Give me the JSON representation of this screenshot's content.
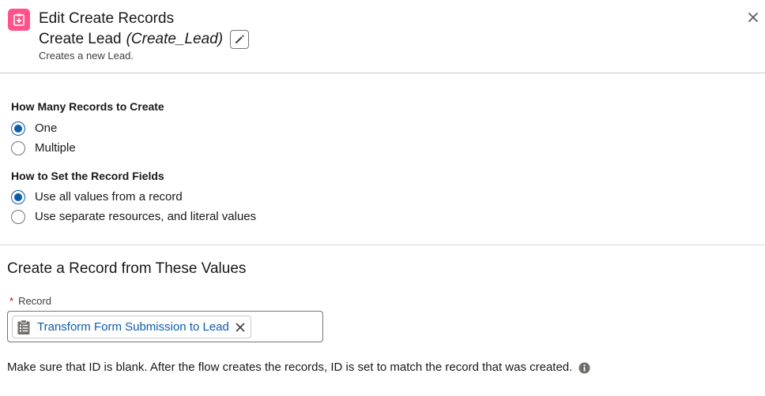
{
  "header": {
    "supertitle": "Edit Create Records",
    "title": "Create Lead",
    "api_name": "(Create_Lead)",
    "description": "Creates a new Lead.",
    "icon": "create-records-icon",
    "icon_color": "#ff538a"
  },
  "how_many": {
    "label": "How Many Records to Create",
    "options": [
      {
        "label": "One",
        "checked": true
      },
      {
        "label": "Multiple",
        "checked": false
      }
    ]
  },
  "how_to_set": {
    "label": "How to Set the Record Fields",
    "options": [
      {
        "label": "Use all values from a record",
        "checked": true
      },
      {
        "label": "Use separate resources, and literal values",
        "checked": false
      }
    ]
  },
  "record_section": {
    "title": "Create a Record from These Values",
    "field_label": "Record",
    "required_marker": "*",
    "selected_value": "Transform Form Submission to Lead",
    "help_text": "Make sure that ID is blank. After the flow creates the records, ID is set to match the record that was created."
  },
  "colors": {
    "accent": "#0b5cab",
    "required": "#ba0517"
  }
}
